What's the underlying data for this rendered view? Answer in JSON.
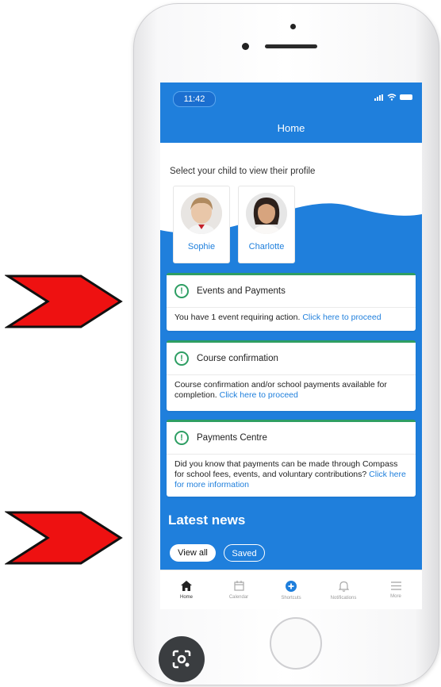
{
  "status_bar": {
    "time": "11:42"
  },
  "header": {
    "title": "Home"
  },
  "profile": {
    "prompt": "Select your child to view their profile",
    "children": [
      {
        "name": "Sophie"
      },
      {
        "name": "Charlotte"
      }
    ]
  },
  "notices": [
    {
      "title": "Events and Payments",
      "body": "You have 1 event requiring action.",
      "link": "Click here to proceed"
    },
    {
      "title": "Course confirmation",
      "body": "Course confirmation and/or school payments available for completion.",
      "link": "Click here to proceed"
    },
    {
      "title": "Payments Centre",
      "body": "Did you know that payments can be made through Compass for school fees, events, and voluntary contributions?",
      "link": "Click here for more information"
    }
  ],
  "news": {
    "title": "Latest news",
    "view_all": "View all",
    "saved": "Saved"
  },
  "tabs": [
    {
      "label": "Home",
      "icon": "home-icon",
      "active": true
    },
    {
      "label": "Calendar",
      "icon": "calendar-icon",
      "active": false
    },
    {
      "label": "Shortcuts",
      "icon": "plus-circle-icon",
      "active": false
    },
    {
      "label": "Notifications",
      "icon": "bell-icon",
      "active": false
    },
    {
      "label": "More",
      "icon": "menu-icon",
      "active": false
    }
  ],
  "colors": {
    "brand_blue": "#1f7fdc",
    "notice_green": "#2e9e63",
    "arrow_red": "#ee1111"
  }
}
